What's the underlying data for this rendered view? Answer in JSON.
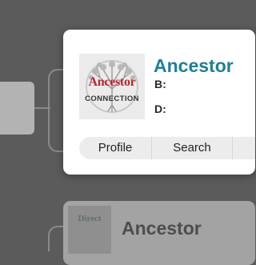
{
  "card": {
    "logo": {
      "word": "Ancestor",
      "sub": "CONNECTION"
    },
    "name": "Ancestor",
    "birth_label": "B:",
    "death_label": "D:",
    "actions": {
      "profile": "Profile",
      "search": "Search"
    }
  },
  "card2": {
    "logo_word": "Direct",
    "name": "Ancestor"
  },
  "colors": {
    "background": "#5b5b5b",
    "name_accent": "#1c8296",
    "logo_red": "#c0262d"
  }
}
